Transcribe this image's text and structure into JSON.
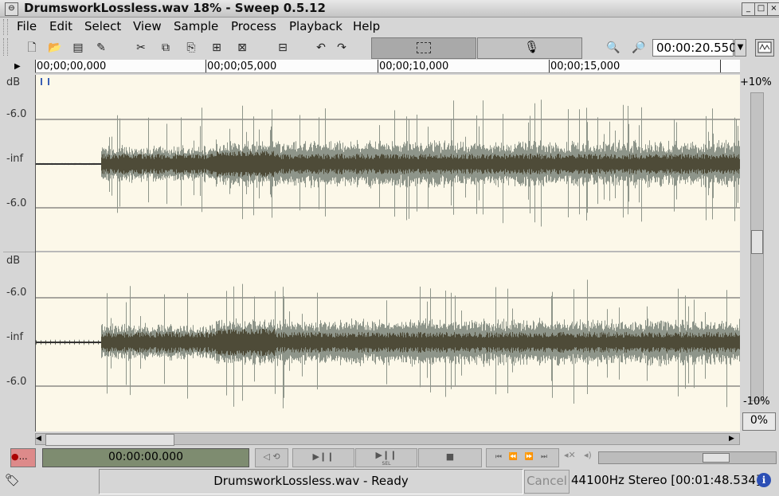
{
  "window": {
    "title": "DrumsworkLossless.wav 18% - Sweep 0.5.12"
  },
  "menu": [
    "File",
    "Edit",
    "Select",
    "View",
    "Sample",
    "Process",
    "Playback",
    "Help"
  ],
  "toolbar": {
    "position_value": "00:00:20.550"
  },
  "ruler": {
    "ticks": [
      "00;00;00,000",
      "00;00;05,000",
      "00;00;10,000",
      "00;00;15,000"
    ]
  },
  "channels": [
    {
      "db_top": "dB",
      "db_upper": "-6.0",
      "db_center": "-inf",
      "db_lower": "-6.0"
    },
    {
      "db_top": "dB",
      "db_upper": "-6.0",
      "db_center": "-inf",
      "db_lower": "-6.0"
    }
  ],
  "gain": {
    "top": "+10%",
    "bottom": "-10%",
    "value": "0%"
  },
  "transport": {
    "record_label": "…",
    "time": "00:00:00.000",
    "play_sel_sub": "SEL"
  },
  "status": {
    "message": "DrumsworkLossless.wav - Ready",
    "cancel": "Cancel",
    "format": "44100Hz Stereo [00:01:48.534]"
  },
  "colors": {
    "wave_bg": "#fcf8e9",
    "wave_outer": "#8e958a",
    "wave_inner": "#4e4b38",
    "time_display": "#7e8c70"
  }
}
